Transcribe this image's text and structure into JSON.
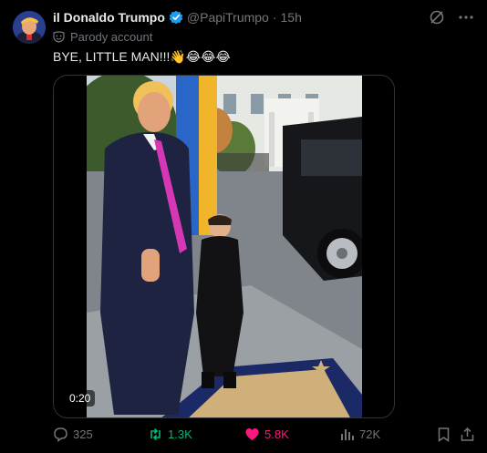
{
  "author": {
    "display_name": "il Donaldo Trumpo",
    "handle": "@PapiTrumpo",
    "separator": "·",
    "time": "15h",
    "verified": true,
    "label": "Parody account"
  },
  "post": {
    "text": "BYE, LITTLE MAN!!!👋😂😂😂"
  },
  "media": {
    "duration": "0:20"
  },
  "actions": {
    "replies": "325",
    "reposts": "1.3K",
    "likes": "5.8K",
    "views": "72K"
  },
  "colors": {
    "background": "#000000",
    "verified": "#1d9bf0",
    "repost": "#00ba7c",
    "like": "#f91880",
    "muted": "#71767b"
  },
  "icons": [
    "verified-badge-icon",
    "parody-mask-icon",
    "grok-icon",
    "more-icon",
    "reply-icon",
    "repost-icon",
    "like-icon",
    "views-icon",
    "bookmark-icon",
    "share-icon"
  ]
}
